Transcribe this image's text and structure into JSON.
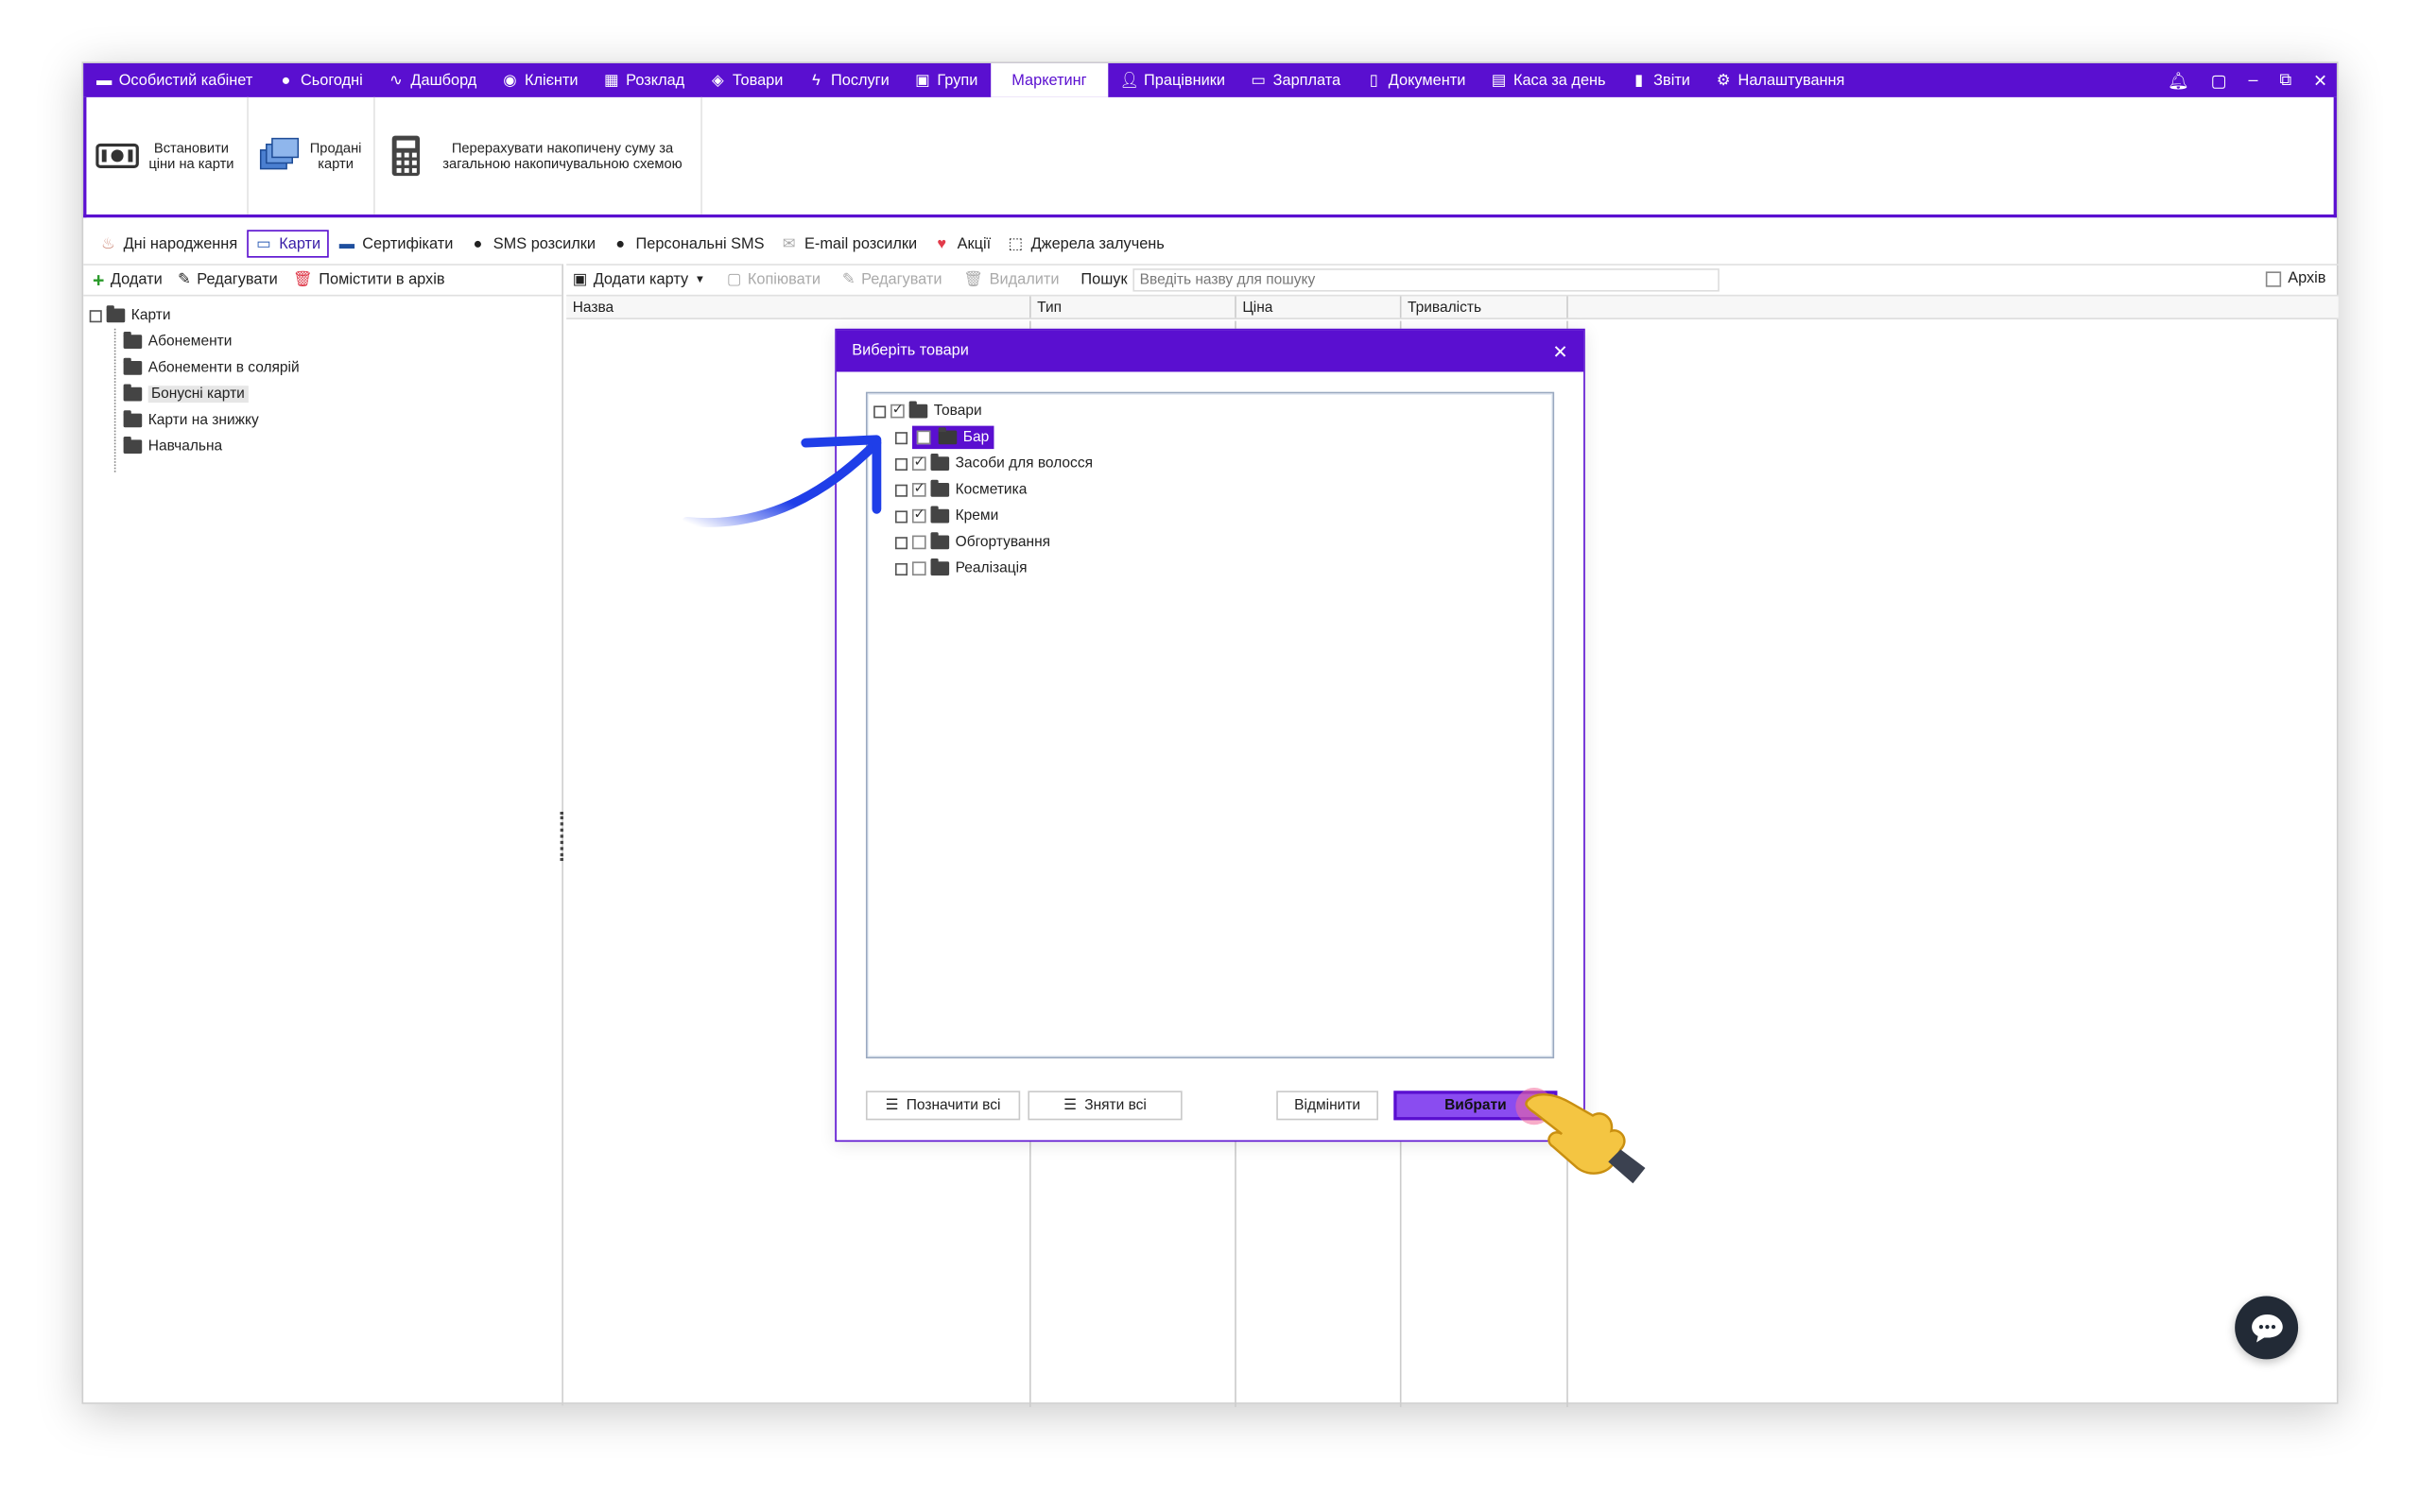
{
  "topnav": {
    "items": [
      {
        "label": "Особистий кабінет",
        "icon": "cabinet-icon"
      },
      {
        "label": "Сьогодні",
        "icon": "today-icon"
      },
      {
        "label": "Дашборд",
        "icon": "pulse-icon"
      },
      {
        "label": "Клієнти",
        "icon": "user-circle-icon"
      },
      {
        "label": "Розклад",
        "icon": "calendar-icon"
      },
      {
        "label": "Товари",
        "icon": "box-icon"
      },
      {
        "label": "Послуги",
        "icon": "lightning-icon"
      },
      {
        "label": "Групи",
        "icon": "groups-icon"
      },
      {
        "label": "Маркетинг",
        "icon": ""
      },
      {
        "label": "Працівники",
        "icon": "person-icon"
      },
      {
        "label": "Зарплата",
        "icon": "money-icon"
      },
      {
        "label": "Документи",
        "icon": "document-icon"
      },
      {
        "label": "Каса за день",
        "icon": "calculator-icon"
      },
      {
        "label": "Звіти",
        "icon": "bar-chart-icon"
      },
      {
        "label": "Налаштування",
        "icon": "gear-icon"
      }
    ],
    "active": "Маркетинг"
  },
  "ribbon": {
    "set_prices": "Встановити ціни на карти",
    "sold_cards": "Продані карти",
    "recalc": "Перерахувати накопичену суму за загальною накопичувальною схемою"
  },
  "subtabs": [
    {
      "label": "Дні народження"
    },
    {
      "label": "Карти"
    },
    {
      "label": "Сертифікати"
    },
    {
      "label": "SMS розсилки"
    },
    {
      "label": "Персональні SMS"
    },
    {
      "label": "E-mail розсилки"
    },
    {
      "label": "Акції"
    },
    {
      "label": "Джерела залучень"
    }
  ],
  "left_toolbar": {
    "add": "Додати",
    "edit": "Редагувати",
    "archive": "Помістити в архів"
  },
  "left_tree": {
    "root": "Карти",
    "children": [
      "Абонементи",
      "Абонементи в солярій",
      "Бонусні карти",
      "Карти на знижку",
      "Навчальна"
    ],
    "selected": "Бонусні карти"
  },
  "right_toolbar": {
    "add_card": "Додати карту",
    "copy": "Копіювати",
    "edit": "Редагувати",
    "delete": "Видалити",
    "search_label": "Пошук",
    "search_placeholder": "Введіть назву для пошуку",
    "archive": "Архів"
  },
  "grid": {
    "columns": [
      "Назва",
      "Тип",
      "Ціна",
      "Тривалість"
    ]
  },
  "dialog": {
    "title": "Виберіть товари",
    "root": "Товари",
    "items": [
      {
        "label": "Бар",
        "checked": false,
        "highlighted": true
      },
      {
        "label": "Засоби для волосся",
        "checked": true
      },
      {
        "label": "Косметика",
        "checked": true
      },
      {
        "label": "Креми",
        "checked": true
      },
      {
        "label": "Обгортування",
        "checked": false
      },
      {
        "label": "Реалізація",
        "checked": false
      }
    ],
    "select_all": "Позначити всі",
    "deselect_all": "Зняти всі",
    "cancel": "Відмінити",
    "choose": "Вибрати"
  },
  "colors": {
    "accent": "#5a0fd0",
    "button": "#8a4cf0",
    "arrow": "#1f3ee8"
  }
}
